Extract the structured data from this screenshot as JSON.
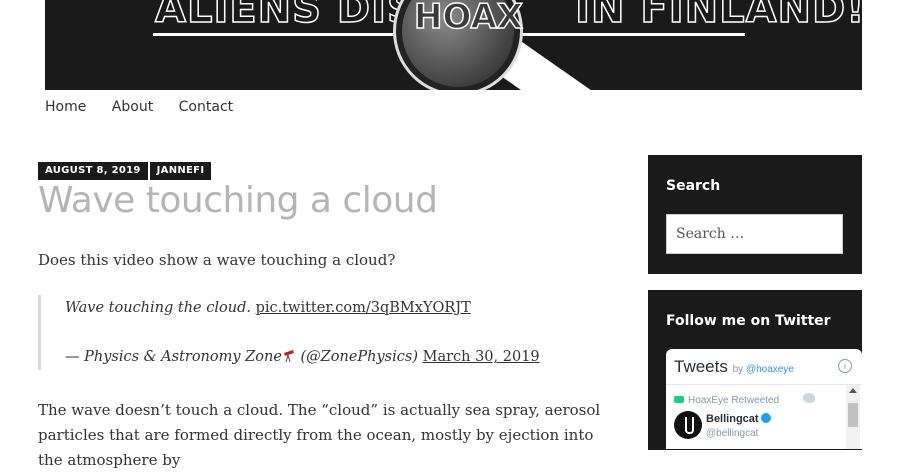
{
  "banner": {
    "title_left": "ALIENS DISC",
    "title_right": "IN FINLAND!",
    "magnifier_word": "HOAX"
  },
  "nav": {
    "items": [
      "Home",
      "About",
      "Contact"
    ]
  },
  "post": {
    "date": "AUGUST 8, 2019",
    "author": "JANNEFI",
    "title": "Wave touching a cloud",
    "intro": "Does this video show a wave touching a cloud?",
    "quote": {
      "text": "Wave touching the cloud. ",
      "link": "pic.twitter.com/3qBMxYORJT",
      "attribution_prefix": "— Physics & Astronomy Zone",
      "attribution_handle": " (@ZonePhysics) ",
      "attribution_date": "March 30, 2019"
    },
    "paragraph": "The wave doesn’t touch a cloud. The “cloud” is actually sea spray, aerosol particles that are formed directly from the ocean, mostly by ejection into the atmosphere by"
  },
  "sidebar": {
    "search": {
      "title": "Search",
      "placeholder": "Search …"
    },
    "twitter": {
      "title": "Follow me on Twitter",
      "widget_title": "Tweets",
      "by_label": "by ",
      "by_handle": "@hoaxeye",
      "retweeted_label": "HoaxEye Retweeted",
      "tweet_name": "Bellingcat",
      "tweet_handle": "@bellingcat"
    }
  },
  "colors": {
    "dark": "#1a1a1a",
    "title_gray": "#b5b5b5",
    "twitter_blue": "#1da1f2",
    "retweet_green": "#19cf86"
  }
}
